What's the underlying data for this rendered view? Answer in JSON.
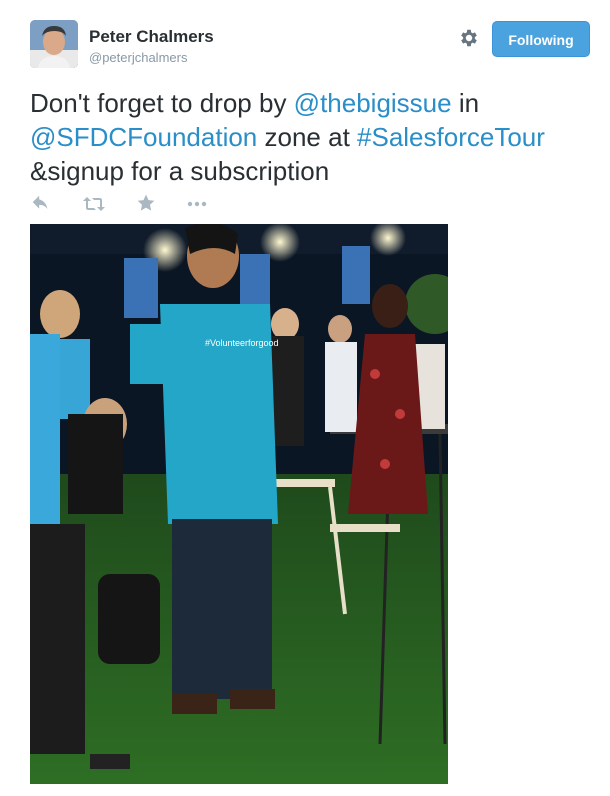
{
  "user": {
    "name": "Peter Chalmers",
    "handle": "@peterjchalmers",
    "avatar_icon": "profile-photo"
  },
  "follow_button": {
    "label": "Following",
    "color": "#4aa3df"
  },
  "settings_icon": "gear-icon",
  "tweet": {
    "segments": [
      {
        "text": "Don't forget to drop by ",
        "type": "text"
      },
      {
        "text": "@thebigissue",
        "type": "mention"
      },
      {
        "text": " in ",
        "type": "text"
      },
      {
        "text": "@SFDCFoundation",
        "type": "mention"
      },
      {
        "text": " zone at ",
        "type": "text"
      },
      {
        "text": "#SalesforceTour",
        "type": "hashtag"
      },
      {
        "text": " &signup for a subscription",
        "type": "text"
      }
    ],
    "link_color": "#2a8ec8"
  },
  "actions": [
    {
      "name": "reply",
      "icon": "reply-icon"
    },
    {
      "name": "retweet",
      "icon": "retweet-icon"
    },
    {
      "name": "favorite",
      "icon": "star-icon"
    },
    {
      "name": "more",
      "icon": "more-icon"
    }
  ],
  "photo": {
    "shirt_text": "#Volunteerforgood"
  }
}
